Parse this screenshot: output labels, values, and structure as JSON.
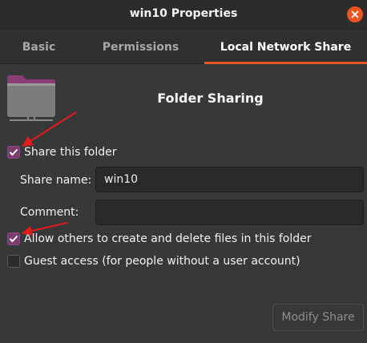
{
  "window": {
    "title": "win10 Properties"
  },
  "tabs": [
    {
      "label": "Basic",
      "active": false
    },
    {
      "label": "Permissions",
      "active": false
    },
    {
      "label": "Local Network Share",
      "active": true
    }
  ],
  "main": {
    "heading": "Folder Sharing",
    "icon": "folder-share-icon",
    "share_folder": {
      "label": "Share this folder",
      "checked": true
    },
    "share_name": {
      "label": "Share name:",
      "value": "win10"
    },
    "comment": {
      "label": "Comment:",
      "value": ""
    },
    "allow_others": {
      "label": "Allow others to create and delete files in this folder",
      "checked": true
    },
    "guest_access": {
      "label": "Guest access (for people without a user account)",
      "checked": false
    },
    "modify_button": "Modify Share"
  },
  "colors": {
    "accent": "#e95420",
    "checkbox": "#7a3d6e",
    "annotation_arrow": "#e21b1b"
  }
}
